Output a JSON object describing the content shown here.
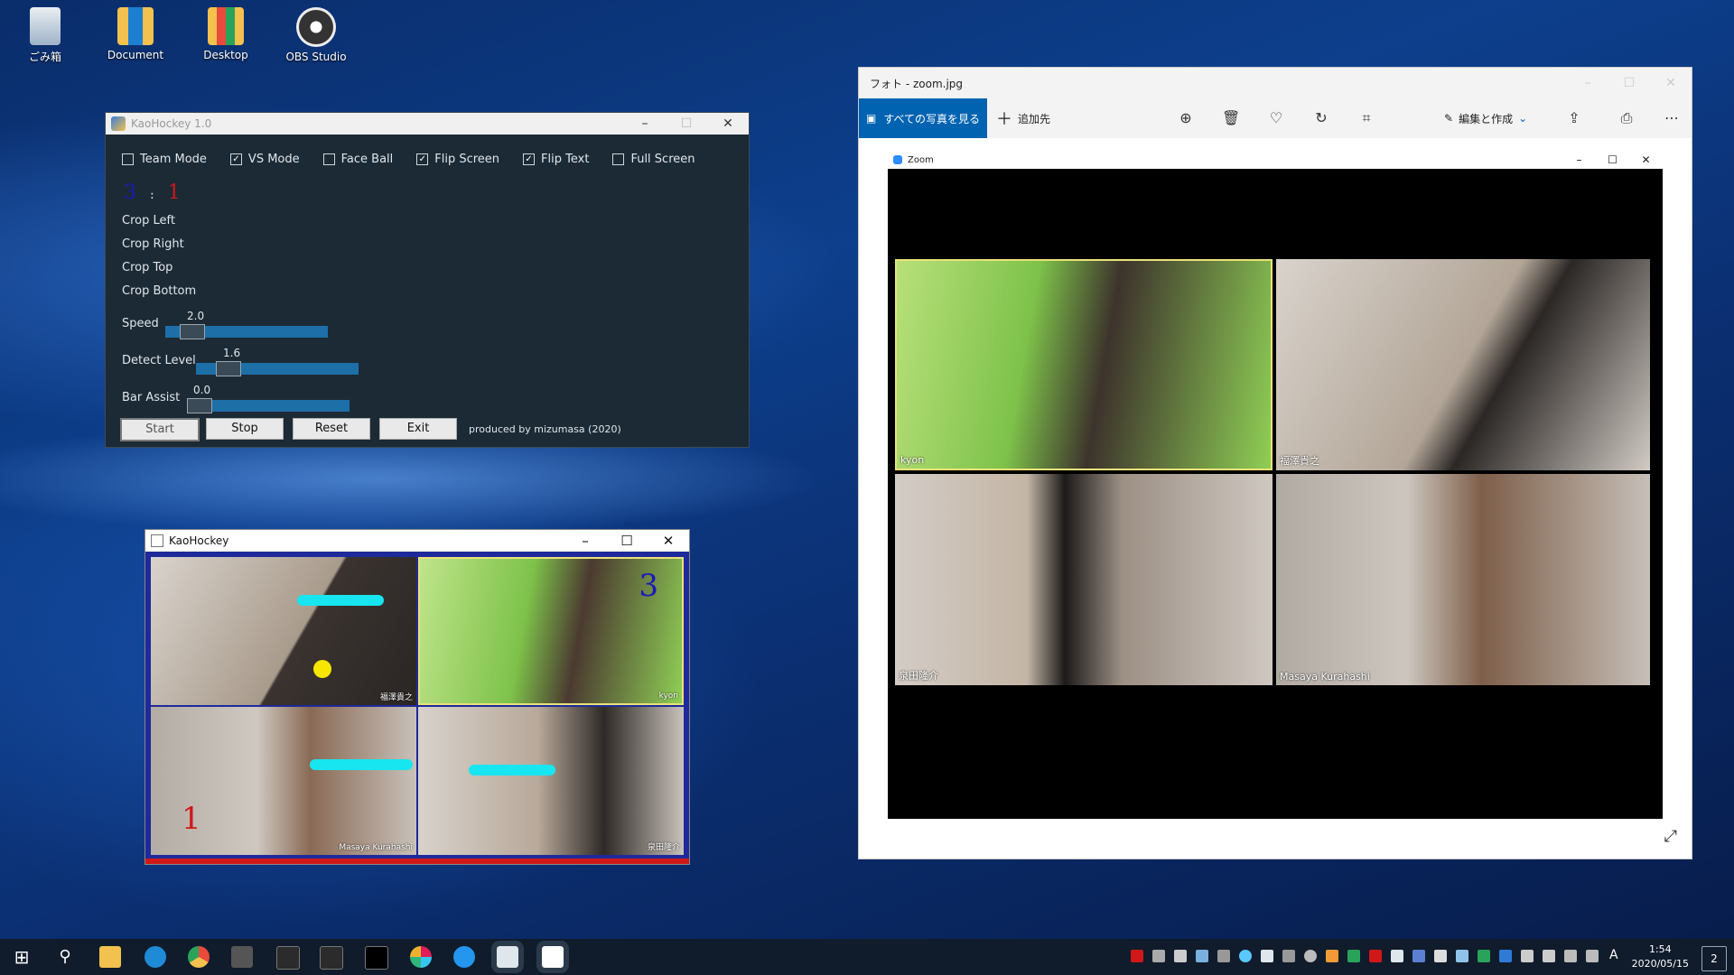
{
  "desktop_icons": [
    {
      "label": "ごみ箱",
      "icon": "recycle-bin-icon"
    },
    {
      "label": "Document",
      "icon": "folder-icon"
    },
    {
      "label": "Desktop",
      "icon": "folder-icon"
    },
    {
      "label": "OBS Studio",
      "icon": "obs-icon"
    }
  ],
  "control_window": {
    "title": "KaoHockey 1.0",
    "checkboxes": [
      {
        "label": "Team Mode",
        "checked": false
      },
      {
        "label": "VS Mode",
        "checked": true
      },
      {
        "label": "Face Ball",
        "checked": false
      },
      {
        "label": "Flip Screen",
        "checked": true
      },
      {
        "label": "Flip Text",
        "checked": true
      },
      {
        "label": "Full Screen",
        "checked": false
      }
    ],
    "score": {
      "blue": "3",
      "sep": ":",
      "red": "1"
    },
    "crop_labels": [
      "Crop Left",
      "Crop Right",
      "Crop Top",
      "Crop Bottom"
    ],
    "sliders": [
      {
        "label": "Speed",
        "value": "2.0"
      },
      {
        "label": "Detect Level",
        "value": "1.6"
      },
      {
        "label": "Bar Assist",
        "value": "0.0"
      }
    ],
    "buttons": {
      "start": "Start",
      "stop": "Stop",
      "reset": "Reset",
      "exit": "Exit"
    },
    "credit": "produced by mizumasa (2020)"
  },
  "game_window": {
    "title": "KaoHockey",
    "blue_score": "3",
    "red_score": "1",
    "names": [
      "福澤貴之",
      "kyon",
      "Masaya Kurahashi",
      "泉田隆介"
    ]
  },
  "photos_window": {
    "title": "フォト - zoom.jpg",
    "all_photos": "すべての写真を見る",
    "add_to": "追加先",
    "edit_create": "編集と作成",
    "zoom_title": "Zoom",
    "participants": [
      "kyon",
      "福澤貴之",
      "泉田隆介",
      "Masaya Kurahashi"
    ]
  },
  "taskbar": {
    "time": "1:54",
    "date": "2020/05/15",
    "notifications": "2",
    "ime": "A"
  },
  "colors": {
    "accent": "#0063b1",
    "score_blue": "#1a1ab8",
    "score_red": "#d01818",
    "bar": "#17e6f0",
    "puck": "#f7e600"
  }
}
